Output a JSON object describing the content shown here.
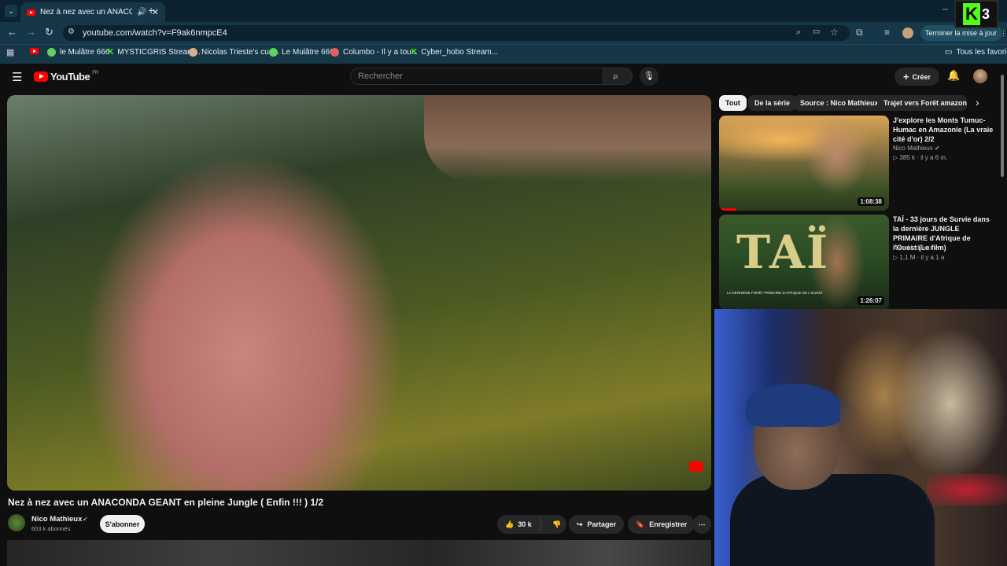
{
  "browser": {
    "tab_title": "Nez à nez avec un ANACONDA",
    "url": "youtube.com/watch?v=F9ak6nmpcE4",
    "update_button": "Terminer la mise à jour",
    "bookmarks": [
      {
        "label": "le Mulâtre 666",
        "color": "#5fd35f"
      },
      {
        "label": "MYSTICGRIS Stream...",
        "color": "#53fc18"
      },
      {
        "label": "Nicolas Trieste's cus...",
        "color": "#d8b08c"
      },
      {
        "label": "Le Mulâtre 666",
        "color": "#5fd35f"
      },
      {
        "label": "Columbo - Il y a tou...",
        "color": "#e06060"
      },
      {
        "label": "Cyber_hobo Stream...",
        "color": "#53fc18"
      }
    ],
    "all_bookmarks": "Tous les favoris"
  },
  "overlay_badge": {
    "letter": "K",
    "number": "3"
  },
  "youtube": {
    "logo_text": "YouTube",
    "logo_region": "FR",
    "search_placeholder": "Rechercher",
    "create_label": "Créer"
  },
  "video": {
    "title": "Nez à nez avec un ANACONDA GEANT en pleine Jungle ( Enfin !!! ) 1/2",
    "channel": "Nico Mathieux",
    "subscribers": "603 k abonnés",
    "subscribe_label": "S'abonner",
    "likes": "30 k",
    "share_label": "Partager",
    "save_label": "Enregistrer"
  },
  "chips": [
    "Tout",
    "De la série",
    "Source : Nico Mathieux",
    "Trajet vers Forêt amazonienne"
  ],
  "recommendations": [
    {
      "title": "J'explore les Monts Tumuc-Humac en Amazonie (La vraie cité d'or) 2/2",
      "channel": "Nico Mathieux",
      "views": "385 k",
      "age": "il y a 6 m.",
      "duration": "1:08:38"
    },
    {
      "title": "TAÏ - 33 jours de Survie dans la dernière JUNGLE PRIMAIRE d'Afrique de l'Ouest (Le film)",
      "channel": "Nico Mathieux",
      "views": "1,1 M",
      "age": "il y a 1 a",
      "duration": "1:26:07",
      "thumb_title": "TAÏ",
      "thumb_caption": "LA DERNIÈRE FORÊT PRIMAIRE D'AFRIQUE DE L'OUEST"
    }
  ]
}
